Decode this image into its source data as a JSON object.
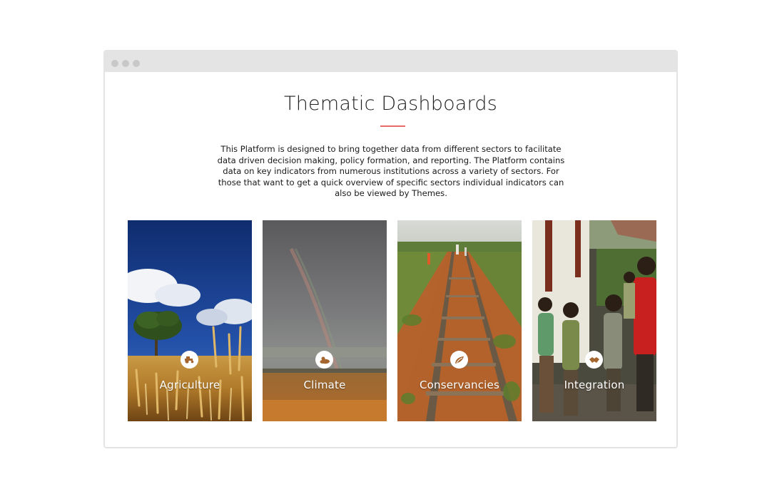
{
  "page": {
    "title": "Thematic Dashboards",
    "intro": "This Platform is designed to bring together data from different sectors to facilitate data driven decision making, policy formation, and reporting. The Platform contains data on key indicators from numerous institutions across a variety of sectors. For those that want to get a quick overview of specific sectors individual indicators can also be viewed by Themes."
  },
  "colors": {
    "accent_underline": "#e66b66",
    "icon_tint": "#a5652f",
    "window_chrome": "#e4e4e4"
  },
  "themes": [
    {
      "label": "Agriculture",
      "icon": "tractor-icon"
    },
    {
      "label": "Climate",
      "icon": "cloud-sun-icon"
    },
    {
      "label": "Conservancies",
      "icon": "leaf-shell-icon"
    },
    {
      "label": "Integration",
      "icon": "handshake-icon"
    }
  ]
}
